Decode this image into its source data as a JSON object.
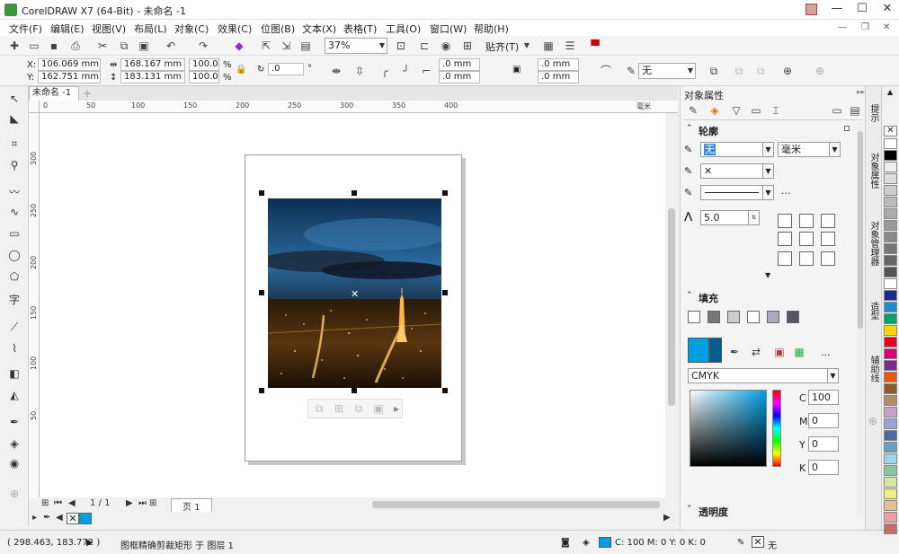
{
  "window": {
    "title": "CorelDRAW X7 (64-Bit) - 未命名 -1",
    "minimize": "—",
    "maximize": "☐",
    "close": "✕"
  },
  "menu": {
    "items": [
      "文件(F)",
      "编辑(E)",
      "视图(V)",
      "布局(L)",
      "对象(C)",
      "效果(C)",
      "位图(B)",
      "文本(X)",
      "表格(T)",
      "工具(O)",
      "窗口(W)",
      "帮助(H)"
    ]
  },
  "toolbar": {
    "zoom_value": "37%",
    "snap_label": "贴齐(T)"
  },
  "propbar": {
    "x_label": "X:",
    "x_value": "106.069 mm",
    "y_label": "Y:",
    "y_value": "162.751 mm",
    "w_value": "168.167 mm",
    "h_value": "183.131 mm",
    "scale_w": "100.0",
    "scale_h": "100.0",
    "pct": "%",
    "rotation": ".0",
    "degree": "°",
    "offset1": ".0 mm",
    "offset2": ".0 mm",
    "offset3": ".0 mm",
    "offset4": ".0 mm",
    "outline_value": "无"
  },
  "doc": {
    "tab_label": "未命名 -1",
    "tab_add": "+"
  },
  "ruler": {
    "h_ticks": [
      "0",
      "50",
      "100",
      "150",
      "200",
      "250",
      "300",
      "350",
      "400"
    ],
    "unit": "毫米",
    "v_ticks": [
      "300",
      "250",
      "200",
      "150",
      "100",
      "50"
    ]
  },
  "pagenav": {
    "page_count": "1 / 1",
    "page_tab": "页 1"
  },
  "status": {
    "coords": "( 298.463, 183.772 )",
    "description": "图框精确剪裁矩形 于 图层 1",
    "fill_cmyk": "C: 100 M: 0 Y: 0 K: 0",
    "outline_none": "无"
  },
  "docker": {
    "title": "对象属性",
    "outline_section": "轮廓",
    "outline_width": "无",
    "outline_unit": "毫米",
    "miter_value": "5.0",
    "fill_section": "填充",
    "color_model": "CMYK",
    "c_label": "C",
    "c_value": "100",
    "m_label": "M",
    "m_value": "0",
    "y_label": "Y",
    "y_value": "0",
    "k_label": "K",
    "k_value": "0",
    "transparency_section": "透明度",
    "ellipsis": "..."
  },
  "vtabs": [
    "提示",
    "对象属性",
    "对象管理器",
    "造型",
    "辅助线"
  ],
  "palette": [
    "#ffffff",
    "#000000",
    "#eeeeee",
    "#dddddd",
    "#cccccc",
    "#bbbbbb",
    "#aaaaaa",
    "#999999",
    "#888888",
    "#777777",
    "#666666",
    "#555555",
    "#ffffff",
    "#1a2b8c",
    "#1f8ad6",
    "#00a36c",
    "#ffd400",
    "#e8001c",
    "#d4007a",
    "#7a2b8c",
    "#e85a00",
    "#8c5a2b",
    "#b48c6a",
    "#c8a0c8",
    "#a0a0d4",
    "#4b6ba0",
    "#6aa0c8",
    "#9ad4e8",
    "#88c8a0",
    "#d4e89a",
    "#f0f080",
    "#e8c090",
    "#e8a0a0",
    "#c86a6a"
  ],
  "colors": {
    "accent": "#009fe3",
    "fill_swatch": "#009fe3",
    "fill_swatch_dark": "#005f8c"
  },
  "icons": [
    "app-logo-icon",
    "user-icon",
    "new-icon",
    "open-icon",
    "save-icon",
    "print-icon",
    "cut-icon",
    "copy-icon",
    "paste-icon",
    "undo-icon",
    "redo-icon",
    "import-icon",
    "export-icon",
    "publish-icon",
    "fullscreen-icon",
    "rulers-icon",
    "grid-icon",
    "guides-icon",
    "options-icon",
    "launch-icon",
    "pick-tool-icon",
    "shape-tool-icon",
    "crop-tool-icon",
    "zoom-tool-icon",
    "freehand-tool-icon",
    "artistic-media-icon",
    "rectangle-tool-icon",
    "ellipse-tool-icon",
    "polygon-tool-icon",
    "text-tool-icon",
    "parallel-dimension-icon",
    "connector-tool-icon",
    "drop-shadow-icon",
    "transparency-tool-icon",
    "eyedropper-tool-icon",
    "interactive-fill-icon",
    "smart-fill-icon",
    "add-tool-icon"
  ]
}
